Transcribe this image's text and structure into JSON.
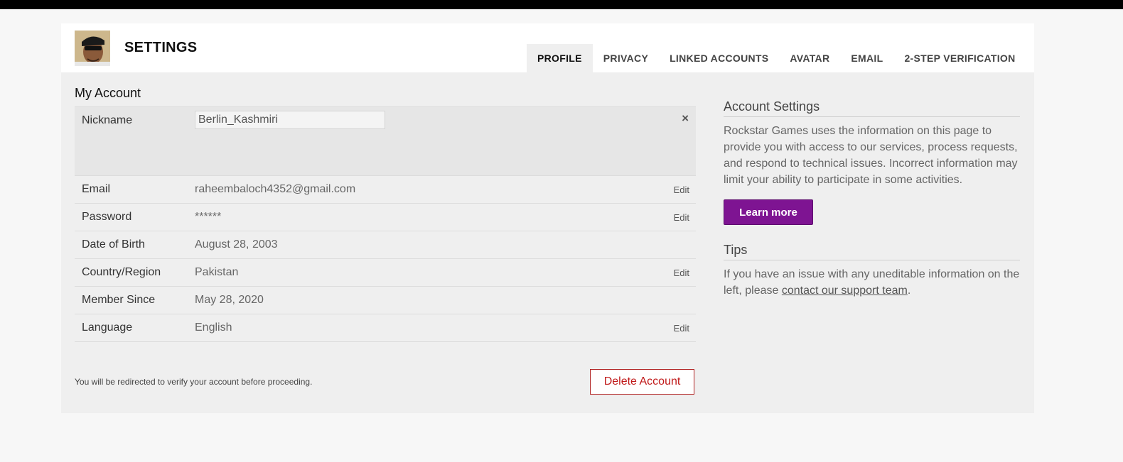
{
  "header": {
    "title": "SETTINGS",
    "tabs": [
      {
        "label": "PROFILE",
        "active": true
      },
      {
        "label": "PRIVACY",
        "active": false
      },
      {
        "label": "LINKED ACCOUNTS",
        "active": false
      },
      {
        "label": "AVATAR",
        "active": false
      },
      {
        "label": "EMAIL",
        "active": false
      },
      {
        "label": "2-STEP VERIFICATION",
        "active": false
      }
    ]
  },
  "account": {
    "heading": "My Account",
    "nickname": {
      "label": "Nickname",
      "value": "Berlin_Kashmiri",
      "close_icon": "×"
    },
    "rows": [
      {
        "label": "Email",
        "value": "raheembaloch4352@gmail.com",
        "edit": "Edit"
      },
      {
        "label": "Password",
        "value": "******",
        "edit": "Edit"
      },
      {
        "label": "Date of Birth",
        "value": "August 28, 2003",
        "edit": ""
      },
      {
        "label": "Country/Region",
        "value": "Pakistan",
        "edit": "Edit"
      },
      {
        "label": "Member Since",
        "value": "May 28, 2020",
        "edit": ""
      },
      {
        "label": "Language",
        "value": "English",
        "edit": "Edit"
      }
    ],
    "redirect_note": "You will be redirected to verify your account before proceeding.",
    "delete_label": "Delete Account"
  },
  "sidebar": {
    "account_settings_title": "Account Settings",
    "account_settings_text": "Rockstar Games uses the information on this page to provide you with access to our services, process requests, and respond to technical issues. Incorrect information may limit your ability to participate in some activities.",
    "learn_more_label": "Learn more",
    "tips_title": "Tips",
    "tips_text_before": "If you have an issue with any uneditable information on the left, please ",
    "tips_link": "contact our support team",
    "tips_text_after": "."
  },
  "colors": {
    "accent_purple": "#7e1492",
    "delete_red": "#c01818",
    "panel_bg": "#efefef"
  },
  "icons": [
    "avatar-image",
    "close-icon"
  ]
}
